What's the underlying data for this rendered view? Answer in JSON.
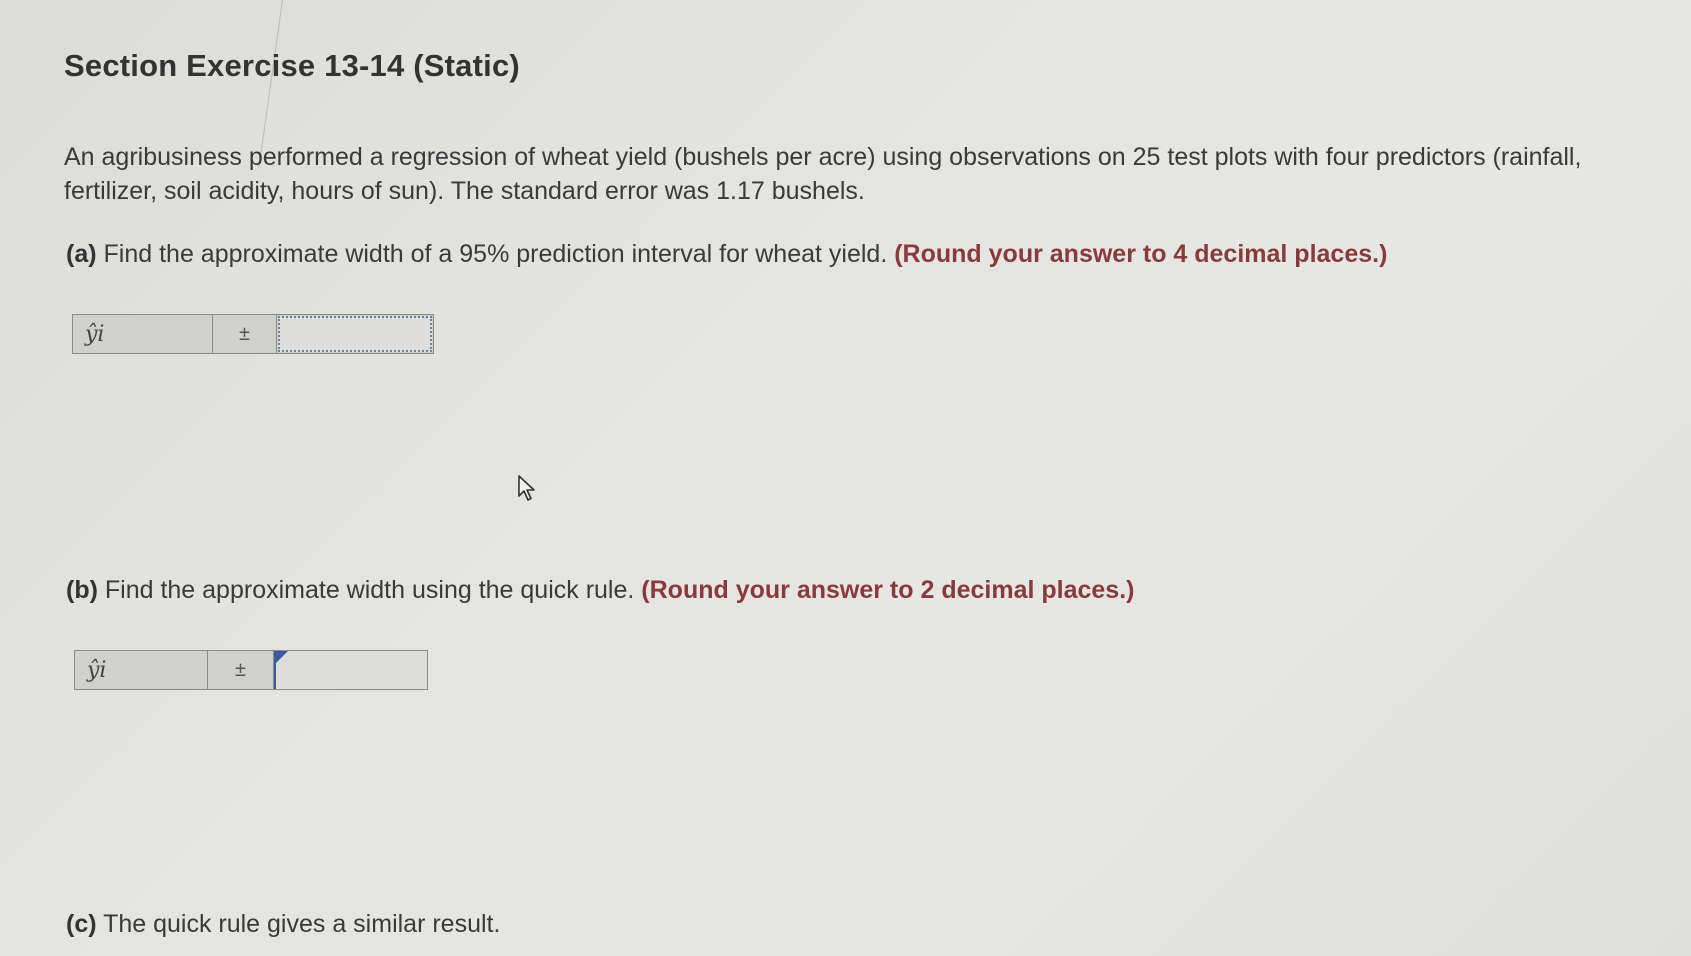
{
  "title": "Section Exercise 13-14 (Static)",
  "intro": "An agribusiness performed a regression of wheat yield (bushels per acre) using observations on 25 test plots with four predictors (rainfall, fertilizer, soil acidity, hours of sun). The standard error was 1.17 bushels.",
  "part_a": {
    "letter": "(a)",
    "text": "Find the approximate width of a 95% prediction interval for wheat yield.",
    "round_note": "(Round your answer to 4 decimal places.)",
    "yhat_label": "ŷi",
    "pm_symbol": "±",
    "answer_value": ""
  },
  "part_b": {
    "letter": "(b)",
    "text": "Find the approximate width using the quick rule.",
    "round_note": "(Round your answer to 2 decimal places.)",
    "yhat_label": "ŷi",
    "pm_symbol": "±",
    "answer_value": ""
  },
  "part_c": {
    "letter": "(c)",
    "text": "The quick rule gives a similar result."
  },
  "icons": {
    "cursor": "arrow-cursor-icon"
  },
  "colors": {
    "round_note": "#8a3a3a",
    "focus_border": "#3a5a9a"
  }
}
